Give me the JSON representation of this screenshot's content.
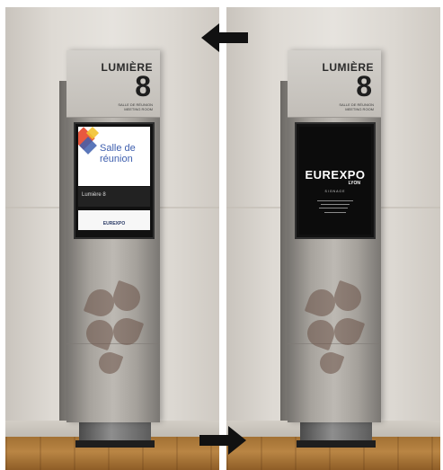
{
  "left_photo": {
    "room_name": "LUMIÈRE",
    "room_number": "8",
    "room_subtitle_1": "SALLE DE RÉUNION",
    "room_subtitle_2": "MEETING ROOM",
    "screen_title_line1": "Salle de",
    "screen_title_line2": "réunion",
    "screen_room_label": "Lumière 8",
    "screen_footer": "EUREXPO"
  },
  "right_photo": {
    "room_name": "LUMIÈRE",
    "room_number": "8",
    "room_subtitle_1": "SALLE DE RÉUNION",
    "room_subtitle_2": "MEETING ROOM",
    "screen_brand": "EUREXPO",
    "screen_brand_city": "LYON",
    "screen_signage": "SIGNAGE"
  },
  "arrows": {
    "top": "➡",
    "bottom": "➡"
  }
}
